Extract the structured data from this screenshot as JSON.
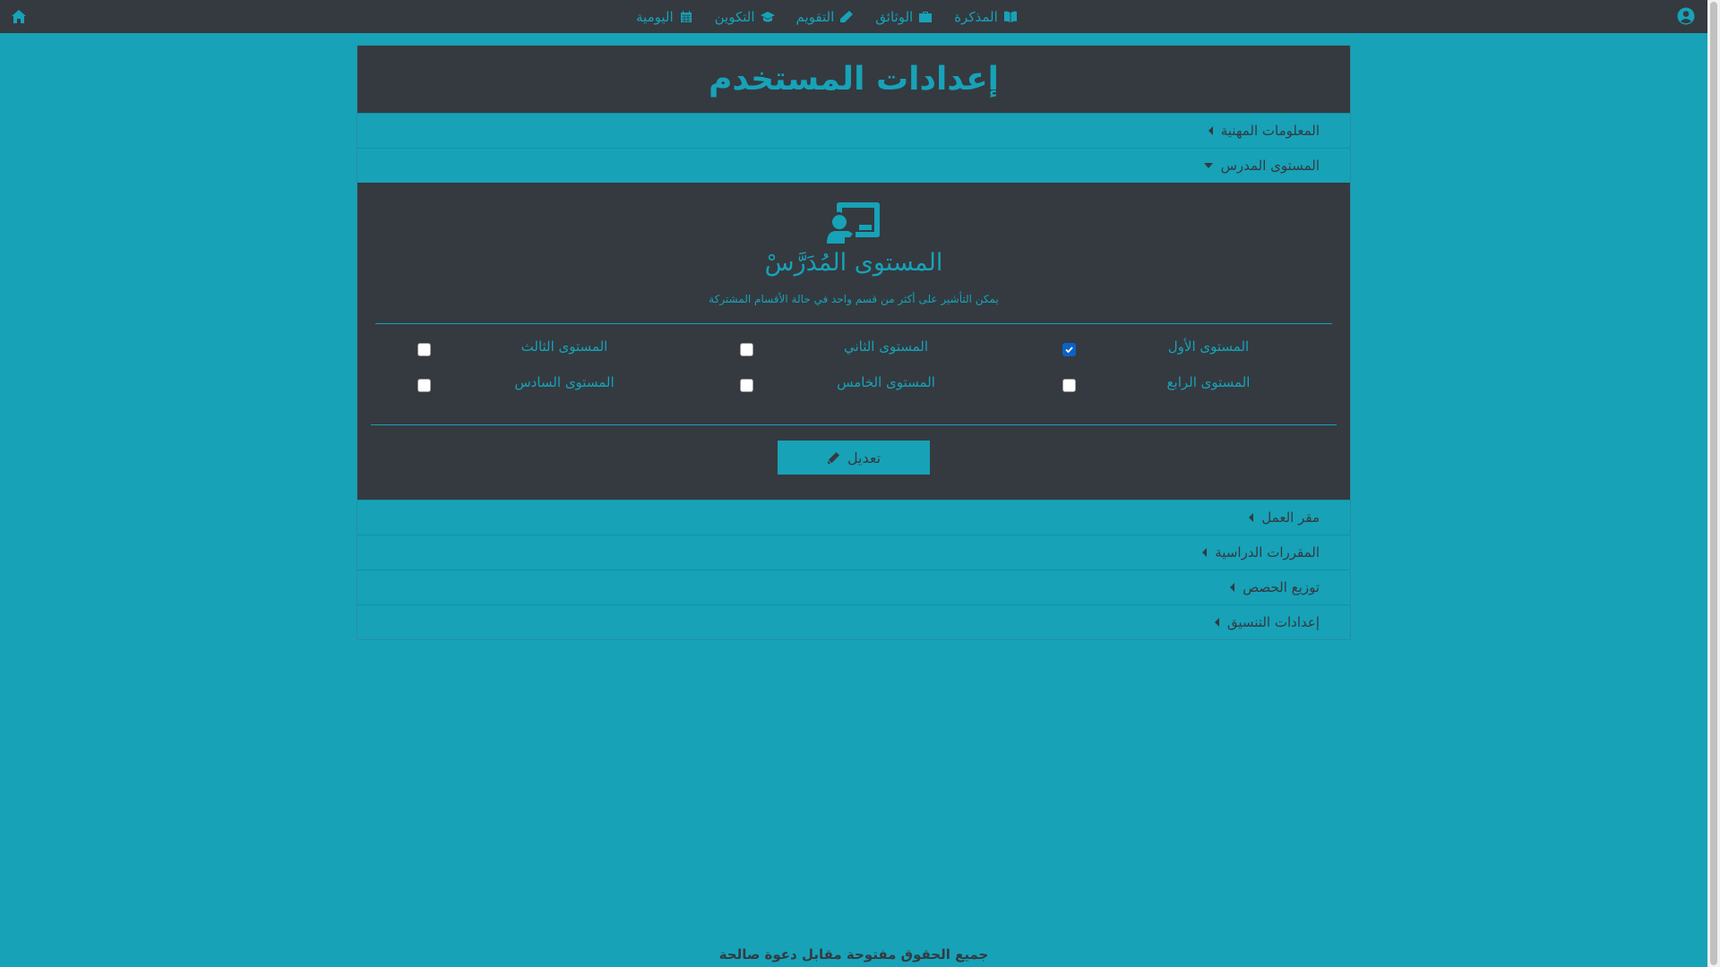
{
  "navbar": {
    "items": [
      {
        "label": "المذكرة",
        "icon": "book-open-icon"
      },
      {
        "label": "الوثائق",
        "icon": "briefcase-icon"
      },
      {
        "label": "التقويم",
        "icon": "pen-icon"
      },
      {
        "label": "التكوين",
        "icon": "graduation-cap-icon"
      },
      {
        "label": "اليومية",
        "icon": "calendar-icon"
      }
    ]
  },
  "page": {
    "title": "إعدادات المستخدم"
  },
  "sections": {
    "professional_info": "المعلومات المهنية",
    "teacher_level": "المستوى المدرس",
    "workplace": "مقر العمل",
    "courses": "المقررات الدراسية",
    "schedule": "توزيع الحصص",
    "coordination": "إعدادات التنسيق"
  },
  "level_panel": {
    "title": "المستوى المُدَرَّسْ",
    "hint": "يمكن التأشير على أكثر من قسم واحد في حالة الأقسام المشتركة",
    "levels": [
      {
        "label": "المستوى الأول",
        "checked": true
      },
      {
        "label": "المستوى الثاني",
        "checked": false
      },
      {
        "label": "المستوى الثالث",
        "checked": false
      },
      {
        "label": "المستوى الرابع",
        "checked": false
      },
      {
        "label": "المستوى الخامس",
        "checked": false
      },
      {
        "label": "المستوى السادس",
        "checked": false
      }
    ],
    "edit_label": "تعديل"
  },
  "footer": {
    "text": "جميع الحقوق مفتوحة مقابل دعوة صالحة"
  },
  "colors": {
    "accent": "#17a2b8",
    "dark": "#343a40",
    "checkbox_checked": "#0b62c4"
  }
}
